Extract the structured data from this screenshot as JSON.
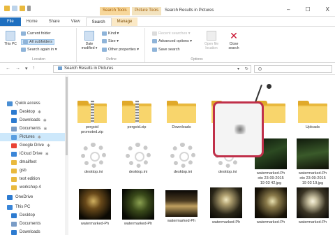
{
  "titlebar": {
    "context_tab_search": "Search Tools",
    "context_tab_picture": "Picture Tools",
    "window_title": "Search Results in Pictures",
    "minimize": "–",
    "maximize": "☐",
    "close": "X"
  },
  "ribbon_tabs": [
    {
      "label": "File"
    },
    {
      "label": "Home"
    },
    {
      "label": "Share"
    },
    {
      "label": "View"
    },
    {
      "label": "Search"
    },
    {
      "label": "Manage"
    }
  ],
  "ribbon": {
    "location": {
      "this_pc": "This PC",
      "current_folder": "Current folder",
      "all_subfolders": "All subfolders",
      "search_again": "Search again in ▾",
      "group_label": "Location"
    },
    "refine": {
      "date_modified": "Date modified ▾",
      "kind": "Kind ▾",
      "size": "Size ▾",
      "other_properties": "Other properties ▾",
      "group_label": "Refine"
    },
    "options": {
      "recent_searches": "Recent searches ▾",
      "advanced_options": "Advanced options ▾",
      "save_search": "Save search",
      "open_file_location": "Open file location",
      "close_search": "Close search",
      "group_label": "Options"
    }
  },
  "address": {
    "nav_back": "←",
    "nav_forward": "→",
    "nav_down": "▾",
    "nav_up": "↑",
    "path": "Search Results in Pictures",
    "dropdown": "▾",
    "refresh": "↻"
  },
  "nav_pane": [
    {
      "label": "Quick access",
      "color": "#4a8fd4",
      "pin": ""
    },
    {
      "label": "Desktop",
      "color": "#2d7bd0",
      "pin": "✱"
    },
    {
      "label": "Downloads",
      "color": "#2d7bd0",
      "pin": "✱"
    },
    {
      "label": "Documents",
      "color": "#7a9cc6",
      "pin": "✱"
    },
    {
      "label": "Pictures",
      "color": "#5a9ee0",
      "pin": "✱"
    },
    {
      "label": "Google Drive",
      "color": "#e94335",
      "pin": "✱"
    },
    {
      "label": "iCloud Drive",
      "color": "#3a86d8",
      "pin": "✱"
    },
    {
      "label": "dmailfeet",
      "color": "#e9b93e",
      "pin": ""
    },
    {
      "label": "gsb",
      "color": "#e9b93e",
      "pin": ""
    },
    {
      "label": "text edition",
      "color": "#e9b93e",
      "pin": ""
    },
    {
      "label": "workshop 4",
      "color": "#e9b93e",
      "pin": ""
    },
    {
      "label": "OneDrive",
      "color": "#2d7bd0",
      "pin": ""
    },
    {
      "label": "This PC",
      "color": "#3a86d8",
      "pin": ""
    },
    {
      "label": "Desktop",
      "color": "#2d7bd0",
      "pin": ""
    },
    {
      "label": "Documents",
      "color": "#7a9cc6",
      "pin": ""
    },
    {
      "label": "Downloads",
      "color": "#2d7bd0",
      "pin": ""
    }
  ],
  "files": {
    "row1": [
      {
        "name": "pergoid\npromoted.zip"
      },
      {
        "name": "pergoid.zip"
      },
      {
        "name": "Downloads"
      },
      {
        "name": ""
      },
      {
        "name": ""
      },
      {
        "name": "Uploads"
      }
    ],
    "row2": [
      {
        "name": "desktop.ini"
      },
      {
        "name": "desktop.ini"
      },
      {
        "name": "desktop.ini"
      },
      {
        "name": "desktop.ini"
      },
      {
        "name": "watermarked-Ph\noto 23-09-2015\n19 03 42.jpg"
      },
      {
        "name": "watermarked-Ph\noto 23-09-2015\n19 03 19.jpg"
      }
    ],
    "row3": [
      {
        "name": "watermarked-Ph"
      },
      {
        "name": "watermarked-Ph"
      },
      {
        "name": "watermarked-Ph"
      },
      {
        "name": "watermarked-Ph"
      },
      {
        "name": "watermarked-Ph"
      },
      {
        "name": "watermarked-Ph"
      }
    ]
  },
  "colors": {
    "accent": "#1f6fbf",
    "callout_frame": "#c0304a",
    "folder": "#f8d56c",
    "highlight": "#ffe400"
  }
}
